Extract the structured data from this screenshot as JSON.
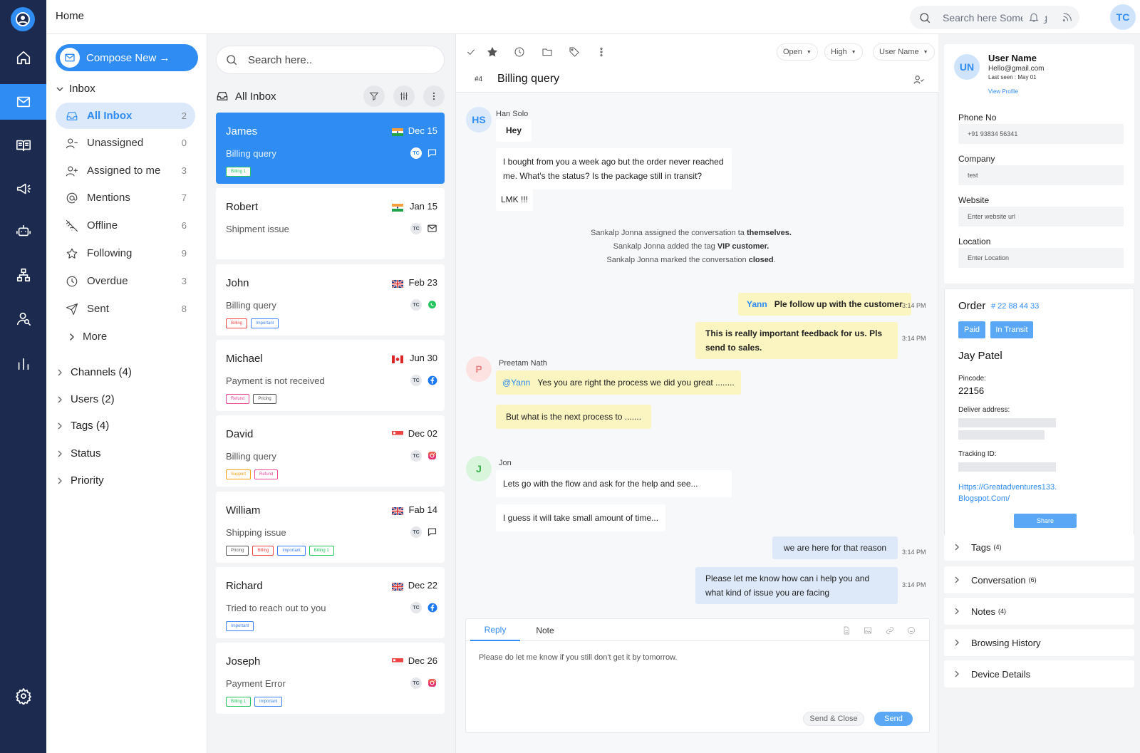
{
  "topbar": {
    "breadcrumb": "Home",
    "search_placeholder": "Search here Something",
    "avatar_initials": "TC"
  },
  "nav": {
    "compose_label": "Compose New →",
    "inbox_label": "Inbox",
    "items": [
      {
        "label": "All Inbox",
        "count": "2",
        "icon": "inbox-icon",
        "active": true
      },
      {
        "label": "Unassigned",
        "count": "0",
        "icon": "user-minus-icon"
      },
      {
        "label": "Assigned to me",
        "count": "3",
        "icon": "user-plus-icon"
      },
      {
        "label": "Mentions",
        "count": "7",
        "icon": "at-icon"
      },
      {
        "label": "Offline",
        "count": "6",
        "icon": "wifi-off-icon"
      },
      {
        "label": "Following",
        "count": "9",
        "icon": "star-icon"
      },
      {
        "label": "Overdue",
        "count": "3",
        "icon": "clock-icon"
      },
      {
        "label": "Sent",
        "count": "8",
        "icon": "send-icon"
      }
    ],
    "more_label": "More",
    "sections": [
      "Channels (4)",
      "Users (2)",
      "Tags (4)",
      "Status",
      "Priority"
    ]
  },
  "list": {
    "search_placeholder": "Search here..",
    "header": "All Inbox",
    "conversations": [
      {
        "name": "James",
        "date": "Dec 15",
        "subject": "Billing query",
        "flag": "india",
        "channel": "chat-icon",
        "tags": [
          {
            "label": "Billing 1",
            "color": "#22c55e"
          }
        ]
      },
      {
        "name": "Robert",
        "date": "Jan 15",
        "subject": "Shipment issue",
        "flag": "india",
        "channel": "mail-icon",
        "tags": []
      },
      {
        "name": "John",
        "date": "Feb 23",
        "subject": "Billing query",
        "flag": "uk",
        "channel": "whatsapp-icon",
        "tags": [
          {
            "label": "Billing",
            "color": "#ef4444"
          },
          {
            "label": "Important",
            "color": "#3b82f6"
          }
        ]
      },
      {
        "name": "Michael",
        "date": "Jun 30",
        "subject": "Payment is not received",
        "flag": "canada",
        "channel": "facebook-icon",
        "tags": [
          {
            "label": "Refund",
            "color": "#ec4899"
          },
          {
            "label": "Pricing",
            "color": "#555555"
          }
        ]
      },
      {
        "name": "David",
        "date": "Dec 02",
        "subject": "Billing query",
        "flag": "singapore",
        "channel": "instagram-icon",
        "tags": [
          {
            "label": "Support",
            "color": "#f59e0b"
          },
          {
            "label": "Refund",
            "color": "#ec4899"
          }
        ]
      },
      {
        "name": "William",
        "date": "Fab 14",
        "subject": "Shipping issue",
        "flag": "uk",
        "channel": "chat-icon",
        "tags": [
          {
            "label": "Pricing",
            "color": "#555555"
          },
          {
            "label": "Billing",
            "color": "#ef4444"
          },
          {
            "label": "Important",
            "color": "#3b82f6"
          },
          {
            "label": "Billing 1",
            "color": "#22c55e"
          }
        ]
      },
      {
        "name": "Richard",
        "date": "Dec 22",
        "subject": "Tried to reach out to you",
        "flag": "uk",
        "channel": "facebook-icon",
        "tags": [
          {
            "label": "Important",
            "color": "#3b82f6"
          }
        ]
      },
      {
        "name": "Joseph",
        "date": "Dec 26",
        "subject": "Payment Error",
        "flag": "singapore",
        "channel": "instagram-icon",
        "tags": [
          {
            "label": "Billing 1",
            "color": "#22c55e"
          },
          {
            "label": "Important",
            "color": "#3b82f6"
          }
        ]
      }
    ],
    "tc_label": "TC"
  },
  "chat": {
    "filters": {
      "status": "Open",
      "priority": "High",
      "user": "User Name"
    },
    "number": "#4",
    "title": "Billing query",
    "msg1_sender": "Han Solo",
    "msg1_initials": "HS",
    "msg1_a": "Hey",
    "msg1_b": "I bought from you a week ago but the order never reached me. What's the status? Is the package still in transit?",
    "msg1_c": "LMK !!!",
    "sys1a": "Sankalp Jonna assigned the conversation ta ",
    "sys1b": "themselves.",
    "sys2a": "Sankalp Jonna added the tag ",
    "sys2b": "VIP customer.",
    "sys3a": "Sankalp Jonna marked the conversation ",
    "sys3b": "closed",
    "sys3c": ".",
    "out1_mention": "Yann",
    "out1_text": "Ple follow up with the customer",
    "out1_time": "3:14 PM",
    "out2_text": "This is really important feedback for us. Pls send to sales.",
    "out2_time": "3:14 PM",
    "msg2_sender": "Preetam Nath",
    "msg2_initials": "P",
    "msg2_mention": "@Yann",
    "msg2_a": "Yes you are right the process we did you great ........",
    "msg2_b": "But what is the next process to .......",
    "msg3_sender": "Jon",
    "msg3_initials": "J",
    "msg3_a": "Lets go with the flow and ask for the help and see...",
    "msg3_b": "I guess it will take small amount of time...",
    "out3_text": "we are here for that reason",
    "out3_time": "3:14 PM",
    "out4_text": "Please let me know how can i help you and what kind of issue you are facing",
    "out4_time": "3:14 PM",
    "reply_tab": "Reply",
    "note_tab": "Note",
    "reply_text": "Please do let me know if you still don't get it by tomorrow.",
    "send_close": "Send & Close",
    "send": "Send"
  },
  "profile": {
    "initials": "UN",
    "name": "User Name",
    "email": "Hello@gmail.com",
    "last_seen": "Last seen : May 01",
    "view_profile": "View Profile",
    "phone_label": "Phone No",
    "phone_value": "+91 93834 56341",
    "company_label": "Company",
    "company_value": "test",
    "website_label": "Website",
    "website_placeholder": "Enter website url",
    "location_label": "Location",
    "location_placeholder": "Enter Location"
  },
  "order": {
    "title": "Order",
    "number": "# 22 88 44 33",
    "badge_paid": "Paid",
    "badge_transit": "In Transit",
    "customer": "Jay Patel",
    "pincode_label": "Pincode:",
    "pincode": "22156",
    "address_label": "Deliver address:",
    "tracking_label": "Tracking ID:",
    "link": "Https://Greatadventures133. Blogspot.Com/",
    "share": "Share"
  },
  "accordions": [
    {
      "label": "Tags",
      "count": "(4)"
    },
    {
      "label": "Conversation",
      "count": "(6)"
    },
    {
      "label": "Notes",
      "count": "(4)"
    },
    {
      "label": "Browsing History",
      "count": ""
    },
    {
      "label": "Device Details",
      "count": ""
    }
  ],
  "colors": {
    "accent": "#2f8cf2",
    "rail": "#1b2a4e",
    "yellow_bubble": "#fbf5c2",
    "blue_bubble": "#dde8f8"
  }
}
